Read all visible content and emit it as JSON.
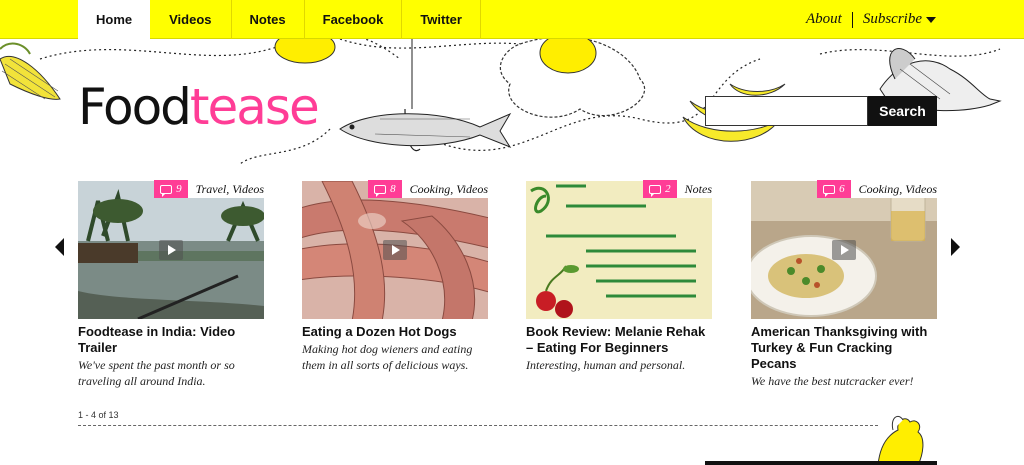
{
  "nav": {
    "tabs": [
      {
        "label": "Home",
        "active": true
      },
      {
        "label": "Videos",
        "active": false
      },
      {
        "label": "Notes",
        "active": false
      },
      {
        "label": "Facebook",
        "active": false
      },
      {
        "label": "Twitter",
        "active": false
      }
    ],
    "about": "About",
    "subscribe": "Subscribe"
  },
  "logo": {
    "food": "Food",
    "tease": "tease"
  },
  "search": {
    "placeholder": "",
    "value": "",
    "button": "Search"
  },
  "colors": {
    "accent": "#ffff00",
    "pink": "#ff3d96"
  },
  "cards": [
    {
      "comments": "9",
      "categories": "Travel, Videos",
      "title": "Foodtease in India: Video Trailer",
      "desc": "We've spent the past month or so traveling all around India.",
      "has_video": true
    },
    {
      "comments": "8",
      "categories": "Cooking, Videos",
      "title": "Eating a Dozen Hot Dogs",
      "desc": "Making hot dog wieners and eating them in all sorts of delicious ways.",
      "has_video": true
    },
    {
      "comments": "2",
      "categories": "Notes",
      "title": "Book Review: Melanie Rehak – Eating For Beginners",
      "desc": "Interesting, human and personal.",
      "has_video": false
    },
    {
      "comments": "6",
      "categories": "Cooking, Videos",
      "title": "American Thanksgiving with Turkey & Fun Cracking Pecans",
      "desc": "We have the best nutcracker ever!",
      "has_video": true
    }
  ],
  "pager": "1 - 4 of 13"
}
